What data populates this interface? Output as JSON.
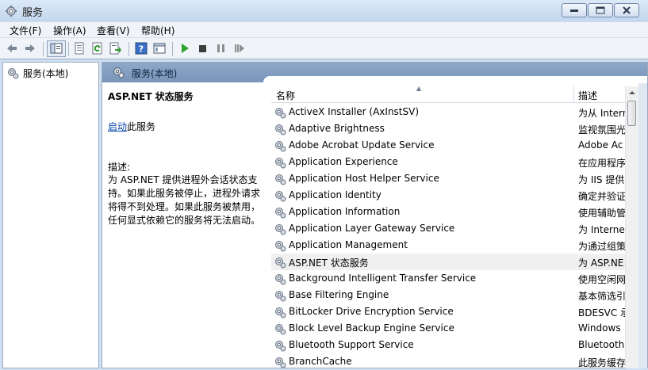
{
  "window": {
    "title": "服务"
  },
  "menu": {
    "items": [
      "文件(F)",
      "操作(A)",
      "查看(V)",
      "帮助(H)"
    ]
  },
  "toolbar": {
    "icons": [
      "back-icon",
      "forward-icon",
      "show-tree-icon",
      "properties-icon",
      "refresh-icon",
      "export-icon",
      "help-icon",
      "details-icon",
      "start-icon",
      "stop-icon",
      "pause-icon",
      "restart-icon"
    ]
  },
  "tree": {
    "root_label": "服务(本地)"
  },
  "main": {
    "header_label": "服务(本地)",
    "service_title": "ASP.NET 状态服务",
    "start_link": "启动",
    "start_suffix": "此服务",
    "desc_label": "描述:",
    "desc_text": "为 ASP.NET 提供进程外会话状态支持。如果此服务被停止，进程外请求将得不到处理。如果此服务被禁用，任何显式依赖它的服务将无法启动。"
  },
  "list": {
    "col_name": "名称",
    "col_desc": "描述",
    "rows": [
      {
        "name": "ActiveX Installer (AxInstSV)",
        "desc": "为从 Intern"
      },
      {
        "name": "Adaptive Brightness",
        "desc": "监视氛围光"
      },
      {
        "name": "Adobe Acrobat Update Service",
        "desc": "Adobe Ac"
      },
      {
        "name": "Application Experience",
        "desc": "在应用程序"
      },
      {
        "name": "Application Host Helper Service",
        "desc": "为 IIS 提供"
      },
      {
        "name": "Application Identity",
        "desc": "确定并验证"
      },
      {
        "name": "Application Information",
        "desc": "使用辅助管"
      },
      {
        "name": "Application Layer Gateway Service",
        "desc": "为 Internet"
      },
      {
        "name": "Application Management",
        "desc": "为通过组策"
      },
      {
        "name": "ASP.NET 状态服务",
        "desc": "为 ASP.NE"
      },
      {
        "name": "Background Intelligent Transfer Service",
        "desc": "使用空闲网"
      },
      {
        "name": "Base Filtering Engine",
        "desc": "基本筛选引"
      },
      {
        "name": "BitLocker Drive Encryption Service",
        "desc": "BDESVC 承"
      },
      {
        "name": "Block Level Backup Engine Service",
        "desc": "Windows"
      },
      {
        "name": "Bluetooth Support Service",
        "desc": "Bluetooth"
      },
      {
        "name": "BranchCache",
        "desc": "此服务缓存"
      }
    ],
    "selected_index": 9
  }
}
